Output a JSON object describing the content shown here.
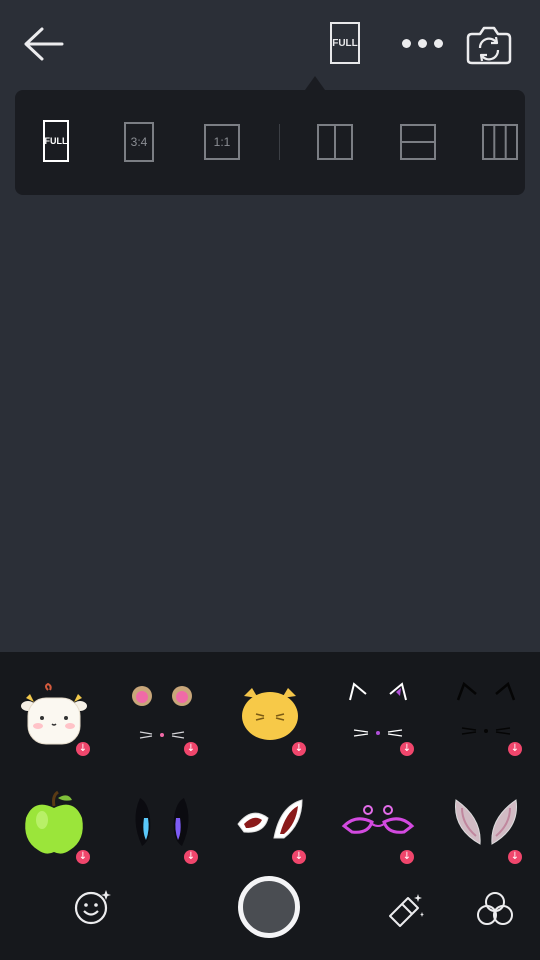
{
  "topbar": {
    "back_icon": "arrow-left-icon",
    "ratio_button_label": "FULL",
    "more_icon": "more-dots-icon",
    "switch_camera_icon": "camera-switch-icon"
  },
  "ratio_menu": {
    "options": [
      {
        "label": "FULL",
        "selected": true
      },
      {
        "label": "3:4",
        "selected": false
      },
      {
        "label": "1:1",
        "selected": false
      }
    ],
    "layouts": [
      {
        "icon": "split-vertical-2-icon"
      },
      {
        "icon": "split-horizontal-2-icon"
      },
      {
        "icon": "split-vertical-3-icon"
      }
    ]
  },
  "stickers": {
    "row1": [
      "cow-face",
      "bear-ears-whiskers",
      "yellow-cat-face",
      "white-cat-ears-whiskers",
      "black-cat-ears-whiskers"
    ],
    "row2": [
      "green-apple",
      "sparkle-bunny-ears",
      "red-glitter-ears",
      "pink-glitter-mask",
      "crystal-bunny-ears"
    ],
    "download_badge": "↓"
  },
  "bottom_bar": {
    "left_icon": "smiley-sparkle-icon",
    "shutter": "shutter-button",
    "beauty_icon": "magic-wand-icon",
    "filter_icon": "filter-circles-icon"
  },
  "colors": {
    "background": "#2b2f37",
    "panel": "#16181c",
    "popup": "#1a1c21",
    "badge": "#f0466c"
  }
}
